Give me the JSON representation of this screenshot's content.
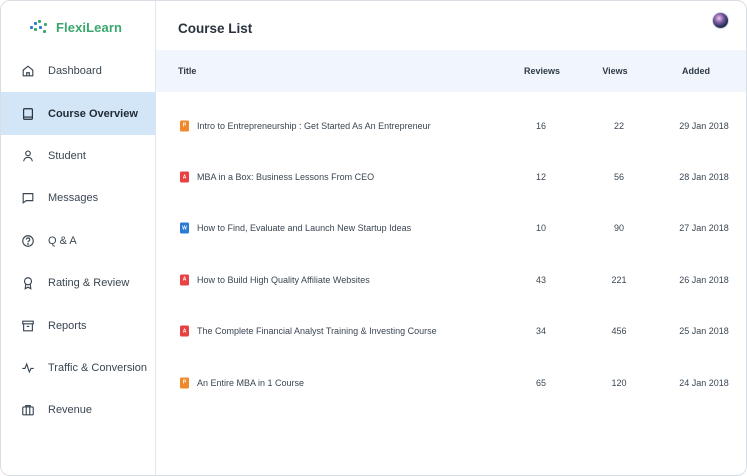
{
  "brand": {
    "name": "FlexiLearn",
    "accent": "#3aa76d"
  },
  "sidebar": {
    "items": [
      {
        "label": "Dashboard",
        "icon": "home-icon",
        "active": false
      },
      {
        "label": "Course Overview",
        "icon": "book-icon",
        "active": true
      },
      {
        "label": "Student",
        "icon": "user-icon",
        "active": false
      },
      {
        "label": "Messages",
        "icon": "message-icon",
        "active": false
      },
      {
        "label": "Q & A",
        "icon": "question-icon",
        "active": false
      },
      {
        "label": "Rating & Review",
        "icon": "award-icon",
        "active": false
      },
      {
        "label": "Reports",
        "icon": "archive-icon",
        "active": false
      },
      {
        "label": "Traffic & Conversion",
        "icon": "activity-icon",
        "active": false
      },
      {
        "label": "Revenue",
        "icon": "briefcase-icon",
        "active": false
      }
    ]
  },
  "header": {
    "title": "Course List"
  },
  "table": {
    "columns": {
      "title": "Title",
      "reviews": "Reviews",
      "views": "Views",
      "added": "Added"
    },
    "rows": [
      {
        "title": "Intro to Entrepreneurship : Get Started As An Entrepreneur",
        "reviews": "16",
        "views": "22",
        "added": "29 Jan 2018",
        "file_type": "slides",
        "icon_color": "#f0892b"
      },
      {
        "title": "MBA in a Box: Business Lessons From CEO",
        "reviews": "12",
        "views": "56",
        "added": "28 Jan 2018",
        "file_type": "pdf",
        "icon_color": "#e84141"
      },
      {
        "title": "How to Find, Evaluate and Launch New Startup Ideas",
        "reviews": "10",
        "views": "90",
        "added": "27 Jan 2018",
        "file_type": "word",
        "icon_color": "#2b7bd6"
      },
      {
        "title": "How to Build High Quality Affiliate Websites",
        "reviews": "43",
        "views": "221",
        "added": "26 Jan 2018",
        "file_type": "pdf",
        "icon_color": "#e84141"
      },
      {
        "title": "The Complete Financial Analyst Training & Investing Course",
        "reviews": "34",
        "views": "456",
        "added": "25 Jan 2018",
        "file_type": "pdf",
        "icon_color": "#e84141"
      },
      {
        "title": "An Entire MBA in 1 Course",
        "reviews": "65",
        "views": "120",
        "added": "24 Jan 2018",
        "file_type": "slides",
        "icon_color": "#f0892b"
      }
    ]
  }
}
